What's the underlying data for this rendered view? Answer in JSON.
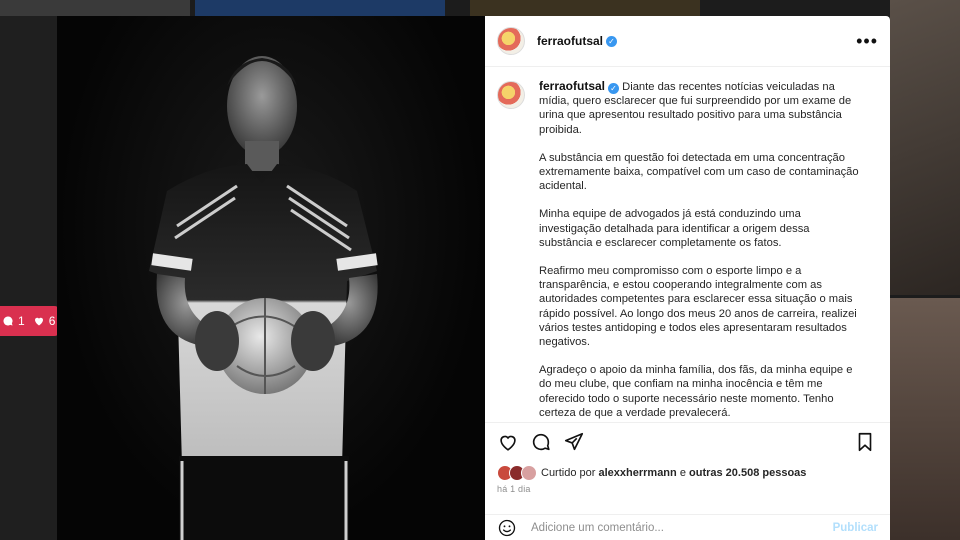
{
  "post": {
    "username": "ferraofutsal",
    "verified": true,
    "caption_paragraphs": [
      "Diante das recentes notícias veiculadas na mídia, quero esclarecer que fui surpreendido por um exame de urina que apresentou resultado positivo para uma substância proibida.",
      "A substância em questão foi detectada em uma concentração extremamente baixa, compatível com um caso de contaminação acidental.",
      "Minha equipe de advogados já está conduzindo uma investigação detalhada para identificar a origem dessa substância e esclarecer completamente os fatos.",
      "Reafirmo meu compromisso com o esporte limpo e a transparência, e estou cooperando integralmente com as autoridades competentes para esclarecer essa situação o mais rápido possível. Ao longo dos meus 20 anos de carreira, realizei vários testes antidoping e todos eles apresentaram resultados negativos.",
      "Agradeço o apoio da minha família, dos fãs, da minha equipe e do meu clube, que confiam na minha inocência e têm me oferecido todo o suporte necessário neste momento. Tenho certeza de que a verdade prevalecerá."
    ],
    "likes": {
      "prefix": "Curtido por",
      "liker": "alexxherrmann",
      "connector": "e",
      "others": "outras 20.508 pessoas"
    },
    "time": "há 1 dia",
    "comment_placeholder": "Adicione um comentário...",
    "publish_label": "Publicar",
    "more_label": "•••"
  },
  "side_badge": {
    "comments": "1",
    "likes": "6"
  },
  "icons": {
    "like": "heart-icon",
    "comment": "comment-icon",
    "share": "share-icon",
    "save": "bookmark-icon",
    "emoji": "emoji-icon",
    "verified": "verified-badge-icon",
    "more": "more-options-icon"
  },
  "colors": {
    "verified_blue": "#3897f0",
    "publish_disabled": "#b2dffc",
    "side_badge": "#d9304f"
  }
}
